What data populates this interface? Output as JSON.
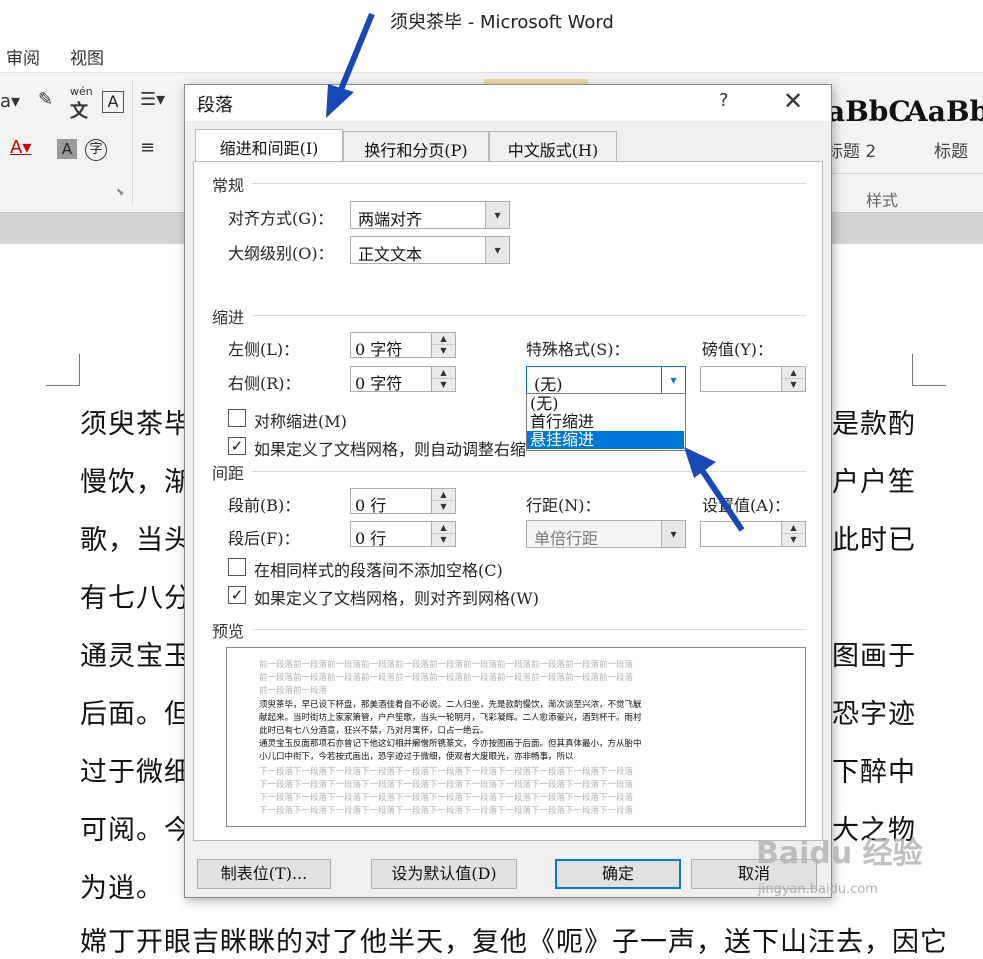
{
  "window": {
    "title": "须臾茶毕 - Microsoft Word"
  },
  "menubar": {
    "items": [
      "审阅",
      "视图"
    ]
  },
  "ribbon": {
    "phonetic_label": "wén",
    "styles": [
      {
        "preview": "aBbC",
        "label": "标题 2"
      },
      {
        "preview": "AaBb",
        "label": "标题"
      }
    ],
    "group_label": "样式"
  },
  "document": {
    "left_lines": [
      "须臾茶毕",
      "慢饮，渐",
      "歌，当头",
      "有七八分",
      "通灵宝玉",
      "后面。但",
      "过于微细",
      "可阅。今",
      "为逍。",
      "嫦丁开眼吉眯眯的对了他半天，复他《呃》子一声，送下山汪去，因它"
    ],
    "right_lines": [
      "是款酌",
      "户户笙",
      "此时已",
      "",
      "图画于",
      "恐字迹",
      "下醉中",
      "大之物"
    ]
  },
  "dialog": {
    "title": "段落",
    "help": "?",
    "close": "✕",
    "tabs": [
      {
        "label": "缩进和间距(I)"
      },
      {
        "label": "换行和分页(P)"
      },
      {
        "label": "中文版式(H)"
      }
    ],
    "general": {
      "heading": "常规",
      "alignment_label": "对齐方式(G)：",
      "alignment_value": "两端对齐",
      "outline_label": "大纲级别(O)：",
      "outline_value": "正文文本"
    },
    "indent": {
      "heading": "缩进",
      "left_label": "左侧(L)：",
      "left_value": "0 字符",
      "right_label": "右侧(R)：",
      "right_value": "0 字符",
      "special_label": "特殊格式(S)：",
      "special_value": "(无)",
      "by_label": "磅值(Y)：",
      "by_value": "",
      "mirror_label": "对称缩进(M)",
      "mirror_checked": false,
      "auto_adjust_label": "如果定义了文档网格，则自动调整右缩进(D)",
      "auto_adjust_checked": true,
      "special_options": [
        "(无)",
        "首行缩进",
        "悬挂缩进"
      ],
      "highlighted_option": "悬挂缩进"
    },
    "spacing": {
      "heading": "间距",
      "before_label": "段前(B)：",
      "before_value": "0 行",
      "after_label": "段后(F)：",
      "after_value": "0 行",
      "line_label": "行距(N)：",
      "line_value": "单倍行距",
      "at_label": "设置值(A)：",
      "at_value": "",
      "no_space_label": "在相同样式的段落间不添加空格(C)",
      "no_space_checked": false,
      "snap_grid_label": "如果定义了文档网格，则对齐到网格(W)",
      "snap_grid_checked": true
    },
    "preview": {
      "heading": "预览",
      "prev_line": "前一段落前一段落前一段落前一段落前一段落前一段落前一段落前一段落前一段落前一段落前一段落",
      "prev_short": "前一段落前一段落",
      "sample_lines": [
        "须臾茶毕，早已设下杯盘，那美酒佳肴自不必说。二人归坐，先是款酌慢饮，渐次谈至兴浓，不觉飞觥",
        "献起来。当时街坊上家家箫管，户户笙歌，当头一轮明月，飞彩凝辉。二人愈添豪兴，酒到杯干。雨村",
        "此时已有七八分酒意，狂兴不禁，乃对月寓怀，口占一绝云。",
        "通灵宝玉反面那项石亦曾记下他这幻相并癞僧所镌篆文，今亦按图画于后面。但其真体最小，方从胎中",
        "小儿口中衔下，今若按式画出，恐字迹过于微细，使观者大废眼光，亦非畅事，所以"
      ],
      "next_line": "下一段落下一段落下一段落下一段落下一段落下一段落下一段落下一段落下一段落下一段落下一段落"
    },
    "buttons": {
      "tabs": "制表位(T)...",
      "set_default": "设为默认值(D)",
      "ok": "确定",
      "cancel": "取消"
    }
  },
  "watermark": {
    "main": "Baidu 经验",
    "sub": "jingyan.baidu.com"
  }
}
